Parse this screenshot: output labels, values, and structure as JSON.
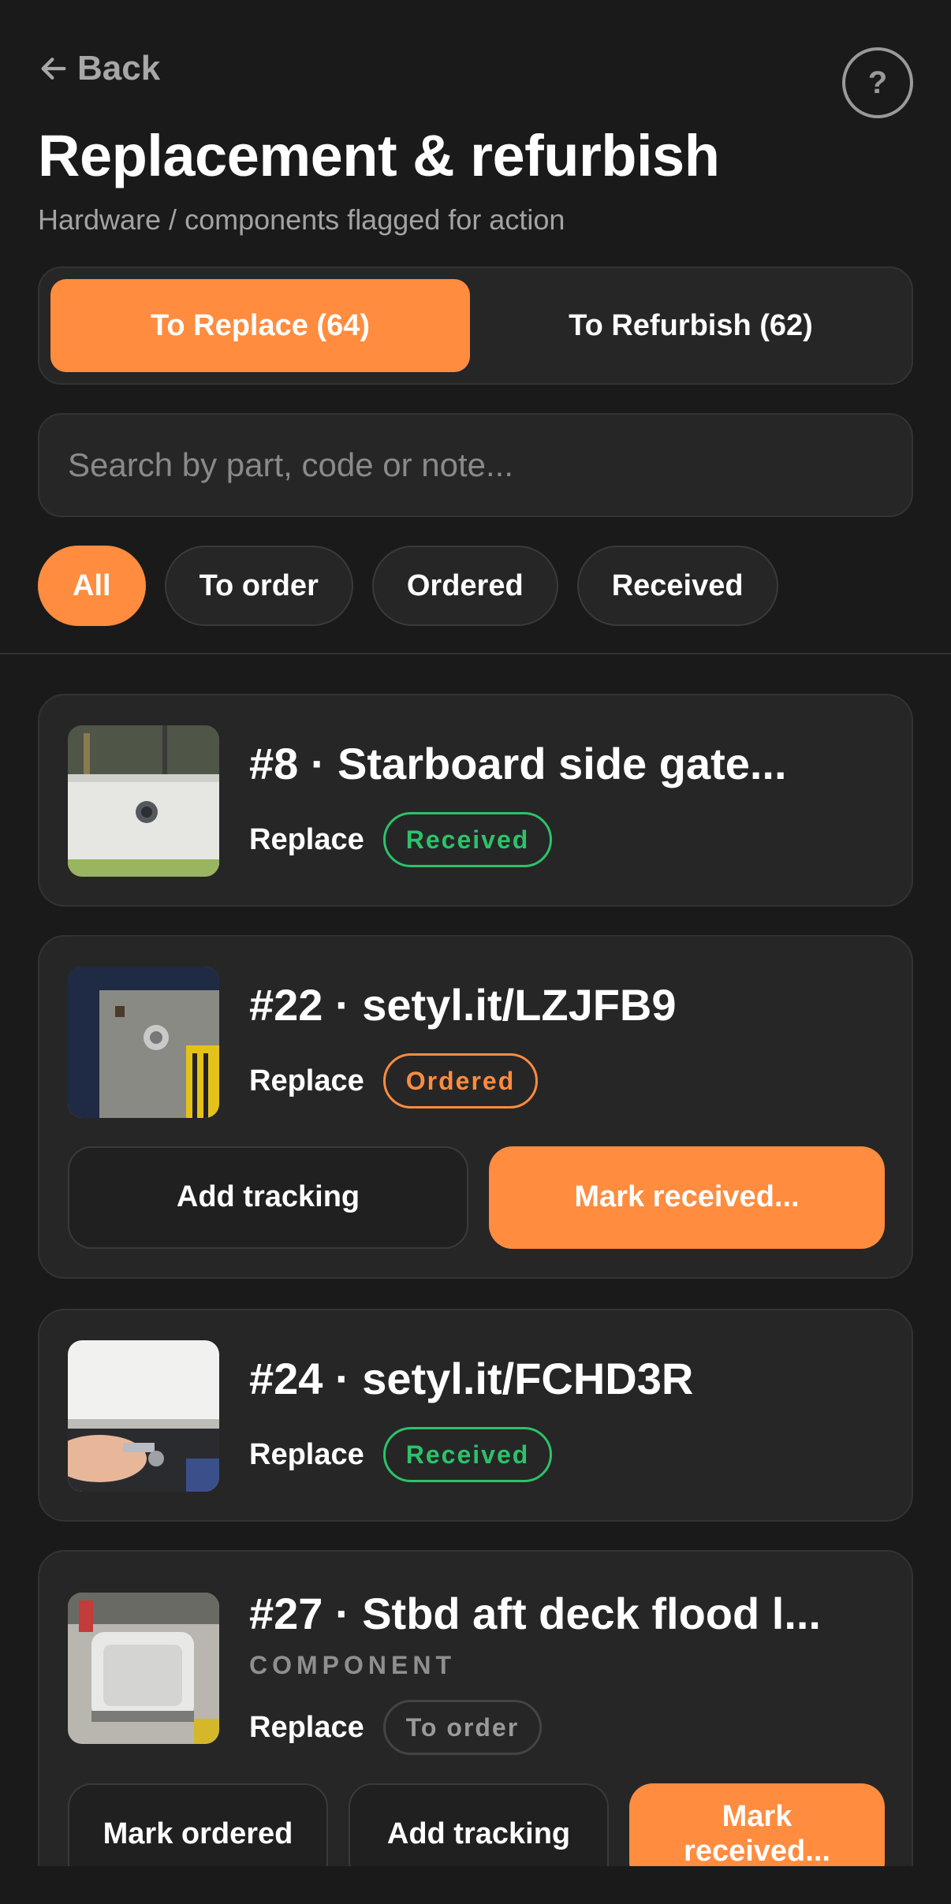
{
  "header": {
    "back_label": "Back",
    "help_label": "?",
    "title": "Replacement & refurbish",
    "subtitle": "Hardware / components flagged for action"
  },
  "segments": {
    "replace": "To Replace (64)",
    "refurbish": "To Refurbish (62)"
  },
  "search": {
    "placeholder": "Search by part, code or note..."
  },
  "filters": [
    "All",
    "To order",
    "Ordered",
    "Received"
  ],
  "items": [
    {
      "title": "#8 · Starboard side gate...",
      "action": "Replace",
      "status": "Received"
    },
    {
      "title": "#22 · setyl.it/LZJFB9",
      "action": "Replace",
      "status": "Ordered",
      "buttons": [
        "Add tracking",
        "Mark received..."
      ]
    },
    {
      "title": "#24 · setyl.it/FCHD3R",
      "action": "Replace",
      "status": "Received"
    },
    {
      "title": "#27 · Stbd aft deck flood l...",
      "kind": "COMPONENT",
      "action": "Replace",
      "status": "To order",
      "buttons": [
        "Mark ordered",
        "Add tracking",
        "Mark received..."
      ]
    }
  ],
  "colors": {
    "accent": "#ff8c3f",
    "received": "#2bc36a",
    "background": "#1a1a1a",
    "card": "#262626"
  },
  "icons": [
    "arrow-left-icon",
    "help-icon"
  ]
}
